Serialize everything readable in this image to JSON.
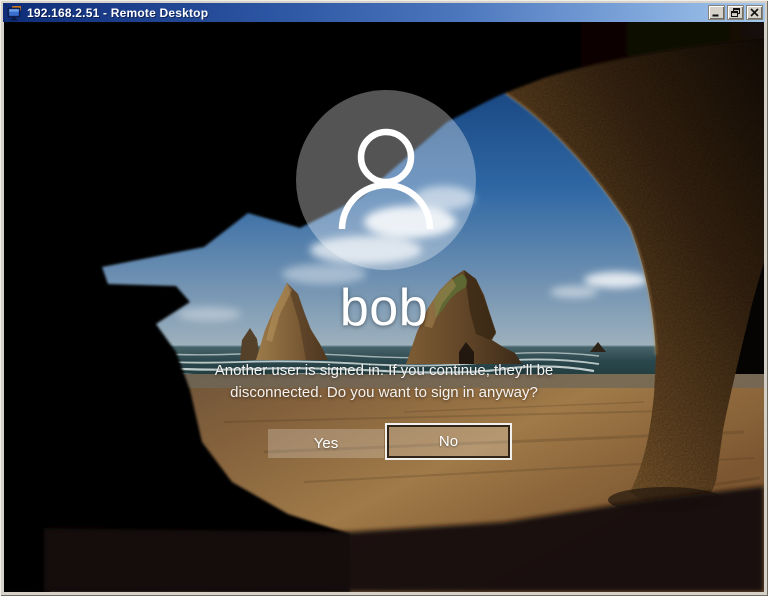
{
  "window": {
    "title": "192.168.2.51 - Remote Desktop",
    "controls": {
      "minimize": "_",
      "restore": "restore",
      "close": "x"
    }
  },
  "logon": {
    "username": "bob",
    "message_line1": "Another user is signed in. If you continue, they’ll be",
    "message_line2": "disconnected. Do you want to sign in anyway?",
    "yes_label": "Yes",
    "no_label": "No",
    "focused_button": "No"
  },
  "colors": {
    "titlebar_left": "#0e2c78",
    "titlebar_right": "#a3c6ec",
    "window_chrome": "#d6d2c9",
    "avatar_fill": "rgba(255,255,255,0.33)",
    "text": "#ffffff",
    "sky_top": "#143f7a",
    "sand": "#8a6740"
  }
}
